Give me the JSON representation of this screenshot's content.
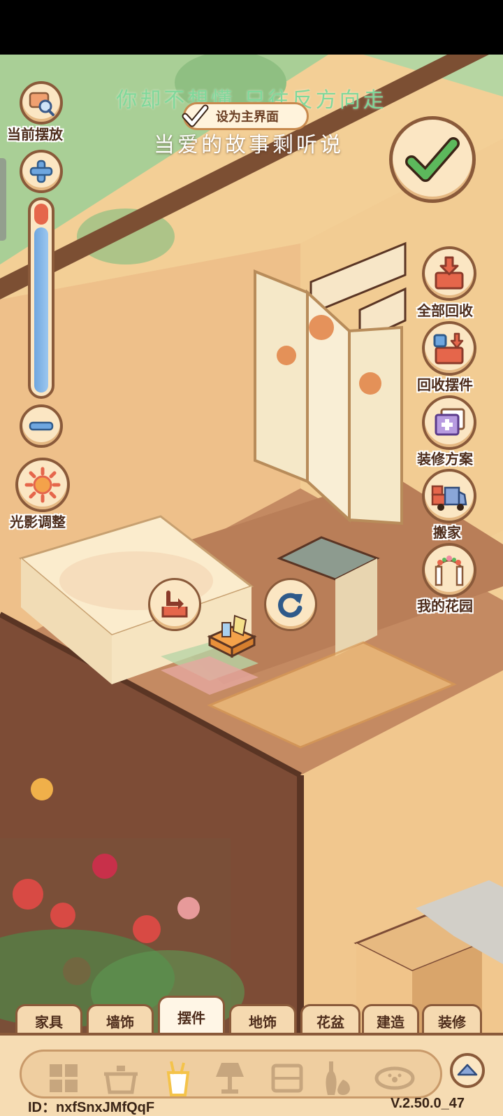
{
  "overlay": {
    "lyric_line_1": "你却不想懂 只往反方向走",
    "lyric_line_2": "当爱的故事剩听说"
  },
  "main_screen_toggle": {
    "label": "设为主界面",
    "checked": true
  },
  "left_controls": {
    "current_placement_label": "当前摆放",
    "lighting_label": "光影调整",
    "zoom_level": 0.88
  },
  "right_controls": {
    "recycle_all_label": "全部回收",
    "recycle_decor_label": "回收摆件",
    "renovation_plan_label": "装修方案",
    "move_house_label": "搬家",
    "my_garden_label": "我的花园"
  },
  "tabs": [
    {
      "label": "家具",
      "active": false
    },
    {
      "label": "墙饰",
      "active": false
    },
    {
      "label": "摆件",
      "active": true
    },
    {
      "label": "地饰",
      "active": false
    },
    {
      "label": "花盆",
      "active": false
    },
    {
      "label": "建造",
      "active": false
    },
    {
      "label": "装修",
      "active": false
    }
  ],
  "categories": [
    {
      "icon": "grid-icon",
      "active": false
    },
    {
      "icon": "pot-icon",
      "active": false
    },
    {
      "icon": "utensil-cup-icon",
      "active": true
    },
    {
      "icon": "lamp-icon",
      "active": false
    },
    {
      "icon": "frame-icon",
      "active": false
    },
    {
      "icon": "vase-icon",
      "active": false
    },
    {
      "icon": "pet-bowl-icon",
      "active": false
    }
  ],
  "footer": {
    "id_text": "ID：nxfSnxJMfQqF",
    "version_text": "V.2.50.0_47"
  },
  "colors": {
    "frame_brown": "#8a5a3a",
    "button_cream": "#fbe6c3",
    "check_green": "#5cb85c",
    "lyric_green": "#7fd89a",
    "accent_red": "#e5664b"
  }
}
